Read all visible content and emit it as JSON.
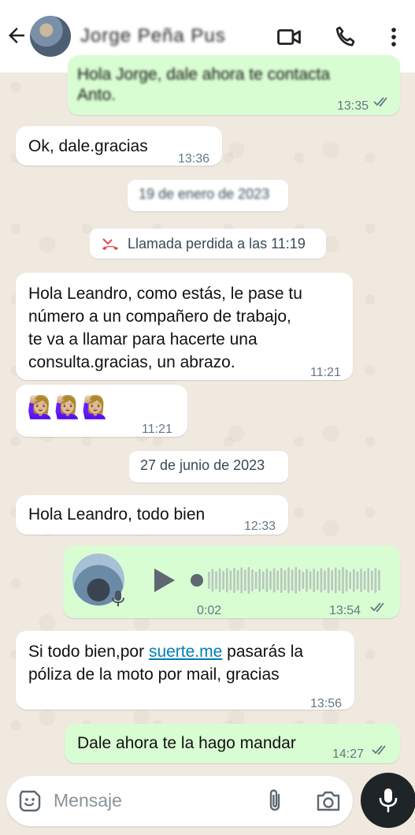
{
  "header": {
    "contact_name": "Jorge Peña Pus"
  },
  "messages": [
    {
      "id": "m1",
      "text_line1": "Hola Jorge, dale ahora te contacta",
      "text_line2": "Anto.",
      "time": "13:35"
    },
    {
      "id": "m2",
      "text": "Ok, dale.gracias",
      "time": "13:36"
    },
    {
      "id": "d1",
      "text": "19 de enero de 2023"
    },
    {
      "id": "call",
      "text": "Llamada perdida a las 11:19"
    },
    {
      "id": "m3",
      "lines": [
        "Hola Leandro, como estás, le pase tu",
        "número a un compañero de trabajo,",
        "te va a llamar para hacerte una",
        "consulta.gracias, un abrazo."
      ],
      "time": "11:21"
    },
    {
      "id": "m4",
      "emoji": "🙋🏼‍♀️🙋🏼‍♀️🙋🏼‍♀️",
      "time": "11:21"
    },
    {
      "id": "d2",
      "text": "27 de junio de 2023"
    },
    {
      "id": "m5",
      "text": "Hola Leandro, todo bien",
      "time": "12:33"
    },
    {
      "id": "voice",
      "duration": "0:02",
      "time": "13:54"
    },
    {
      "id": "m6",
      "line1_pre": "Si todo bien,por ",
      "link": "suerte.me",
      "line1_post": " pasarás la",
      "line2": "póliza de la moto por mail, gracias",
      "time": "13:56"
    },
    {
      "id": "m7",
      "text": "Dale ahora te la hago mandar",
      "time": "14:27"
    }
  ],
  "composer": {
    "placeholder": "Mensaje"
  },
  "colors": {
    "incoming": "#ffffff",
    "outgoing": "#d9fdd3",
    "link": "#027eb5",
    "read_tick": "#53bdeb",
    "missed_call": "#e5484d"
  }
}
